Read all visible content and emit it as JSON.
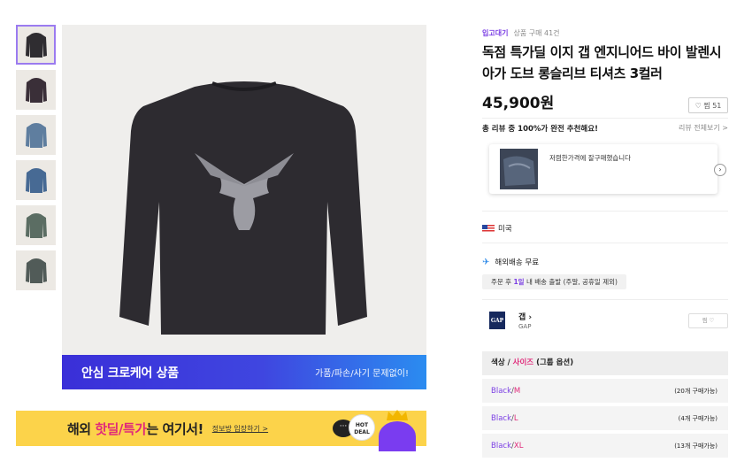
{
  "thumbnails": [
    {
      "color": "#2f2d31",
      "selected": true
    },
    {
      "color": "#3a2f38",
      "selected": false
    },
    {
      "color": "#5f7e9f",
      "selected": false
    },
    {
      "color": "#476a94",
      "selected": false
    },
    {
      "color": "#5b6d63",
      "selected": false
    },
    {
      "color": "#515b58",
      "selected": false
    }
  ],
  "care_banner": {
    "title": "안심 크로케어 상품",
    "subtitle": "가품/파손/사기 문제없이!"
  },
  "deal_banner": {
    "prefix": "해외 ",
    "highlight": "핫딜/특가",
    "suffix": "는 여기서!",
    "link": "정보방 입장하기 >",
    "bubble": "···",
    "hot": "HOT DEAL"
  },
  "product": {
    "shop": "입고대기",
    "purchase_count": "상품 구매 41건",
    "title": "독점 특가딜 이지 갭 엔지니어드 바이 발렌시아가 도브 롱슬리브 티셔츠 3컬러",
    "price": "45,900원",
    "like_label": "♡ 찜 51"
  },
  "review": {
    "headline": "총 리뷰 중 100%가 완전 추천해요!",
    "view_all": "리뷰 전체보기 >",
    "snippet": "저렴한가격에 잘구매했습니다",
    "next": "›"
  },
  "origin": {
    "label": "미국"
  },
  "shipping": {
    "label": "해외배송 무료",
    "plane": "✈",
    "note_pre": "주문 후 ",
    "note_hl": "1일",
    "note_post": " 내 배송 출발 (주말, 공휴일 제외)"
  },
  "brand": {
    "logo": "GAP",
    "name": "갭 ›",
    "sub": "GAP",
    "follow": "찜 ♡"
  },
  "options": {
    "head_color": "색상",
    "head_sep": " / ",
    "head_size": "사이즈",
    "head_group": " (그룹 옵션)",
    "rows": [
      {
        "color": "Black",
        "size": "M",
        "count": "(20개 구매가능)"
      },
      {
        "color": "Black",
        "size": "L",
        "count": "(4개 구매가능)"
      },
      {
        "color": "Black",
        "size": "XL",
        "count": "(13개 구매가능)"
      }
    ]
  },
  "colors": {
    "accent": "#7b3fe4",
    "pink": "#e0297a",
    "banner_blue": "#3a2fd8",
    "banner_yellow": "#fcd34a"
  }
}
